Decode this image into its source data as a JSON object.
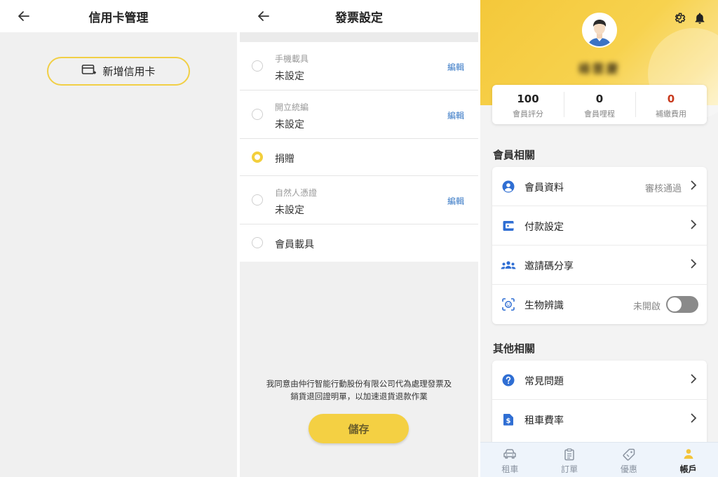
{
  "screen1": {
    "title": "信用卡管理",
    "add_card_label": "新增信用卡"
  },
  "screen2": {
    "title": "發票設定",
    "options": [
      {
        "sub": "手機載具",
        "main": "未設定",
        "edit": "編輯",
        "selected": false
      },
      {
        "sub": "開立統編",
        "main": "未設定",
        "edit": "編輯",
        "selected": false
      },
      {
        "main": "捐贈",
        "selected": true
      },
      {
        "sub": "自然人憑證",
        "main": "未設定",
        "edit": "編輯",
        "selected": false
      },
      {
        "main": "會員載具",
        "selected": false
      }
    ],
    "consent_line1": "我同意由仲行智能行動股份有限公司代為處理發票及",
    "consent_line2": "銷貨退回證明單，以加速退貨退款作業",
    "save_label": "儲存"
  },
  "screen3": {
    "user_name": "楊雲慶",
    "stats": [
      {
        "value": "100",
        "label": "會員評分"
      },
      {
        "value": "0",
        "label": "會員哩程"
      },
      {
        "value": "0",
        "label": "補繳費用"
      }
    ],
    "member_section": {
      "title": "會員相關",
      "items": [
        {
          "label": "會員資料",
          "value": "審核通過",
          "icon": "person-circle-icon"
        },
        {
          "label": "付款設定",
          "icon": "wallet-icon"
        },
        {
          "label": "邀請碼分享",
          "icon": "group-icon"
        },
        {
          "label": "生物辨識",
          "value": "未開啟",
          "icon": "face-id-icon",
          "toggle": false
        }
      ]
    },
    "other_section": {
      "title": "其他相關",
      "items": [
        {
          "label": "常見問題",
          "icon": "help-circle-icon"
        },
        {
          "label": "租車費率",
          "icon": "dollar-doc-icon"
        }
      ]
    },
    "tabs": [
      {
        "label": "租車",
        "icon": "car-icon"
      },
      {
        "label": "訂單",
        "icon": "clipboard-icon"
      },
      {
        "label": "優惠",
        "icon": "tag-icon"
      },
      {
        "label": "帳戶",
        "icon": "person-icon",
        "active": true
      }
    ],
    "accent_color": "#f4c83a",
    "icon_blue": "#2f6ed3",
    "alert_red": "#c83a1e"
  }
}
